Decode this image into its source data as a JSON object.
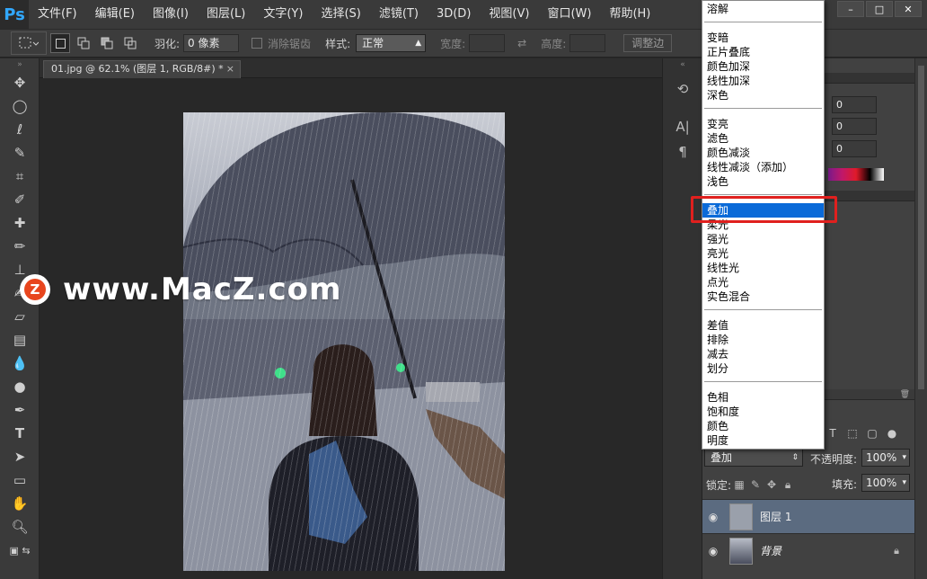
{
  "app": {
    "logo": "Ps"
  },
  "menu": [
    "文件(F)",
    "编辑(E)",
    "图像(I)",
    "图层(L)",
    "文字(Y)",
    "选择(S)",
    "滤镜(T)",
    "3D(D)",
    "视图(V)",
    "窗口(W)",
    "帮助(H)"
  ],
  "window_controls": [
    "–",
    "□",
    "✕"
  ],
  "options": {
    "feather_label": "羽化:",
    "feather_value": "0 像素",
    "antialias_label": "消除锯齿",
    "style_label": "样式:",
    "style_value": "正常",
    "width_label": "宽度:",
    "height_label": "高度:",
    "refine_button": "调整边"
  },
  "document": {
    "tab_title": "01.jpg @ 62.1% (图层 1, RGB/8#) *",
    "tab_close": "×"
  },
  "watermark": {
    "logo_letter": "Z",
    "text": "www.MacZ.com"
  },
  "panel_inputs": [
    "0",
    "0",
    "0"
  ],
  "layers_panel": {
    "blend_mode": "叠加",
    "opacity_label": "不透明度:",
    "opacity_value": "100%",
    "lock_label": "锁定:",
    "fill_label": "填充:",
    "fill_value": "100%",
    "layers": [
      {
        "name": "图层 1",
        "selected": true
      },
      {
        "name": "背景",
        "selected": false
      }
    ]
  },
  "blend_dropdown": {
    "items": [
      {
        "label": "溶解",
        "group": 0
      },
      {
        "label": "变暗",
        "group": 1
      },
      {
        "label": "正片叠底",
        "group": 1
      },
      {
        "label": "颜色加深",
        "group": 1
      },
      {
        "label": "线性加深",
        "group": 1
      },
      {
        "label": "深色",
        "group": 1
      },
      {
        "label": "变亮",
        "group": 2
      },
      {
        "label": "滤色",
        "group": 2
      },
      {
        "label": "颜色减淡",
        "group": 2
      },
      {
        "label": "线性减淡（添加）",
        "group": 2
      },
      {
        "label": "浅色",
        "group": 2
      },
      {
        "label": "叠加",
        "group": 3,
        "highlighted": true
      },
      {
        "label": "柔光",
        "group": 3
      },
      {
        "label": "强光",
        "group": 3
      },
      {
        "label": "亮光",
        "group": 3
      },
      {
        "label": "线性光",
        "group": 3
      },
      {
        "label": "点光",
        "group": 3
      },
      {
        "label": "实色混合",
        "group": 3
      },
      {
        "label": "差值",
        "group": 4
      },
      {
        "label": "排除",
        "group": 4
      },
      {
        "label": "减去",
        "group": 4
      },
      {
        "label": "划分",
        "group": 4
      },
      {
        "label": "色相",
        "group": 5
      },
      {
        "label": "饱和度",
        "group": 5
      },
      {
        "label": "颜色",
        "group": 5
      },
      {
        "label": "明度",
        "group": 5
      }
    ]
  }
}
